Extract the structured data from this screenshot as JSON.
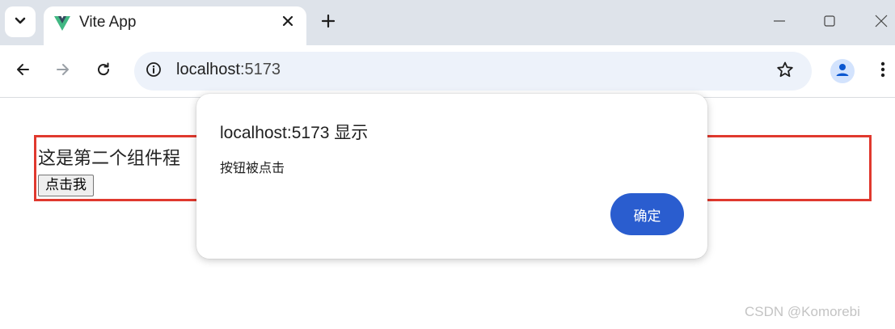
{
  "browser": {
    "tab": {
      "title": "Vite App",
      "favicon": "vue-logo-icon"
    },
    "icons": {
      "tab_search": "chevron-down-icon",
      "tab_close": "close-icon",
      "new_tab": "plus-icon",
      "minimize": "minimize-icon",
      "maximize": "maximize-icon",
      "close_window": "close-icon",
      "back": "arrow-left-icon",
      "forward": "arrow-right-icon",
      "reload": "reload-icon",
      "site_info": "info-icon",
      "bookmark": "star-icon",
      "profile": "person-icon",
      "menu": "kebab-menu-icon"
    },
    "omnibox": {
      "host": "localhost",
      "port": ":5173"
    }
  },
  "page": {
    "component_text": "这是第二个组件程",
    "button_label": "点击我",
    "border_color": "#e0392e"
  },
  "dialog": {
    "title": "localhost:5173 显示",
    "message": "按钮被点击",
    "ok_label": "确定",
    "ok_color": "#2a5dcf"
  },
  "watermark": "CSDN @Komorebi"
}
